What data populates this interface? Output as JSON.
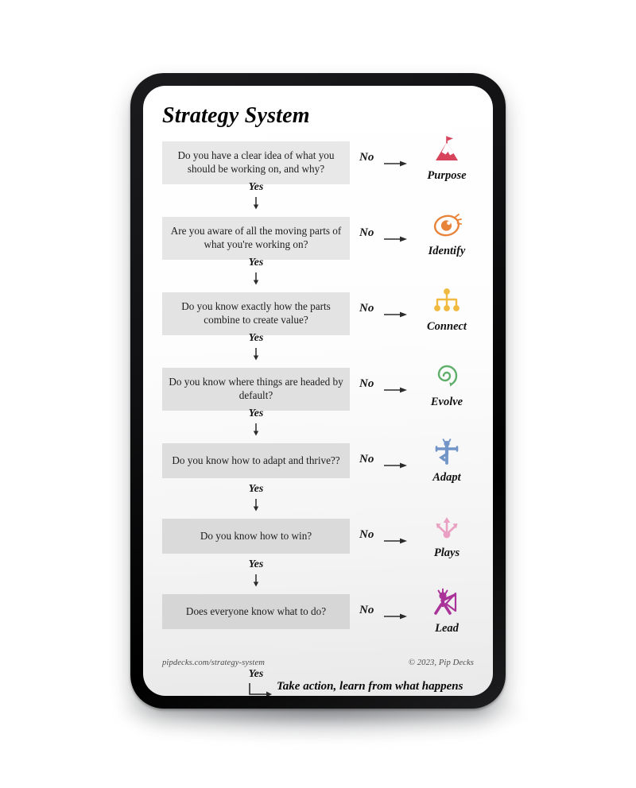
{
  "card": {
    "title": "Strategy System",
    "yes_label": "Yes",
    "no_label": "No",
    "final_text": "Take action, learn from what happens and go again!",
    "footer_left": "pipdecks.com/strategy-system",
    "footer_right": "© 2023, Pip Decks"
  },
  "steps": [
    {
      "question": "Do you have a clear idea of what you should be working on, and why?",
      "no_label": "No",
      "yes_label": "Yes",
      "icon": "mountain-flag-icon",
      "icon_label": "Purpose",
      "color": "#D6435B",
      "box_shade": "#e8e8e8"
    },
    {
      "question": "Are you aware of all the moving parts of what you're working on?",
      "no_label": "No",
      "yes_label": "Yes",
      "icon": "eye-icon",
      "icon_label": "Identify",
      "color": "#E8833A",
      "box_shade": "#e6e6e6"
    },
    {
      "question": "Do you know exactly how the parts combine to create value?",
      "no_label": "No",
      "yes_label": "Yes",
      "icon": "org-chart-icon",
      "icon_label": "Connect",
      "color": "#F0B93F",
      "box_shade": "#e3e3e3"
    },
    {
      "question": "Do you know where things are headed by default?",
      "no_label": "No",
      "yes_label": "Yes",
      "icon": "spiral-arrow-icon",
      "icon_label": "Evolve",
      "color": "#5FAF6B",
      "box_shade": "#e0e0e0"
    },
    {
      "question": "Do you know how to adapt and thrive??",
      "no_label": "No",
      "yes_label": "Yes",
      "icon": "yoga-pose-icon",
      "icon_label": "Adapt",
      "color": "#7295C8",
      "box_shade": "#dddddd"
    },
    {
      "question": "Do you know how to win?",
      "no_label": "No",
      "yes_label": "Yes",
      "icon": "three-arrows-icon",
      "icon_label": "Plays",
      "color": "#E9A0C2",
      "box_shade": "#dadada"
    },
    {
      "question": "Does everyone know what to do?",
      "no_label": "No",
      "yes_label": "Yes",
      "icon": "flag-bearer-icon",
      "icon_label": "Lead",
      "color": "#A93399",
      "box_shade": "#d6d6d6"
    }
  ]
}
